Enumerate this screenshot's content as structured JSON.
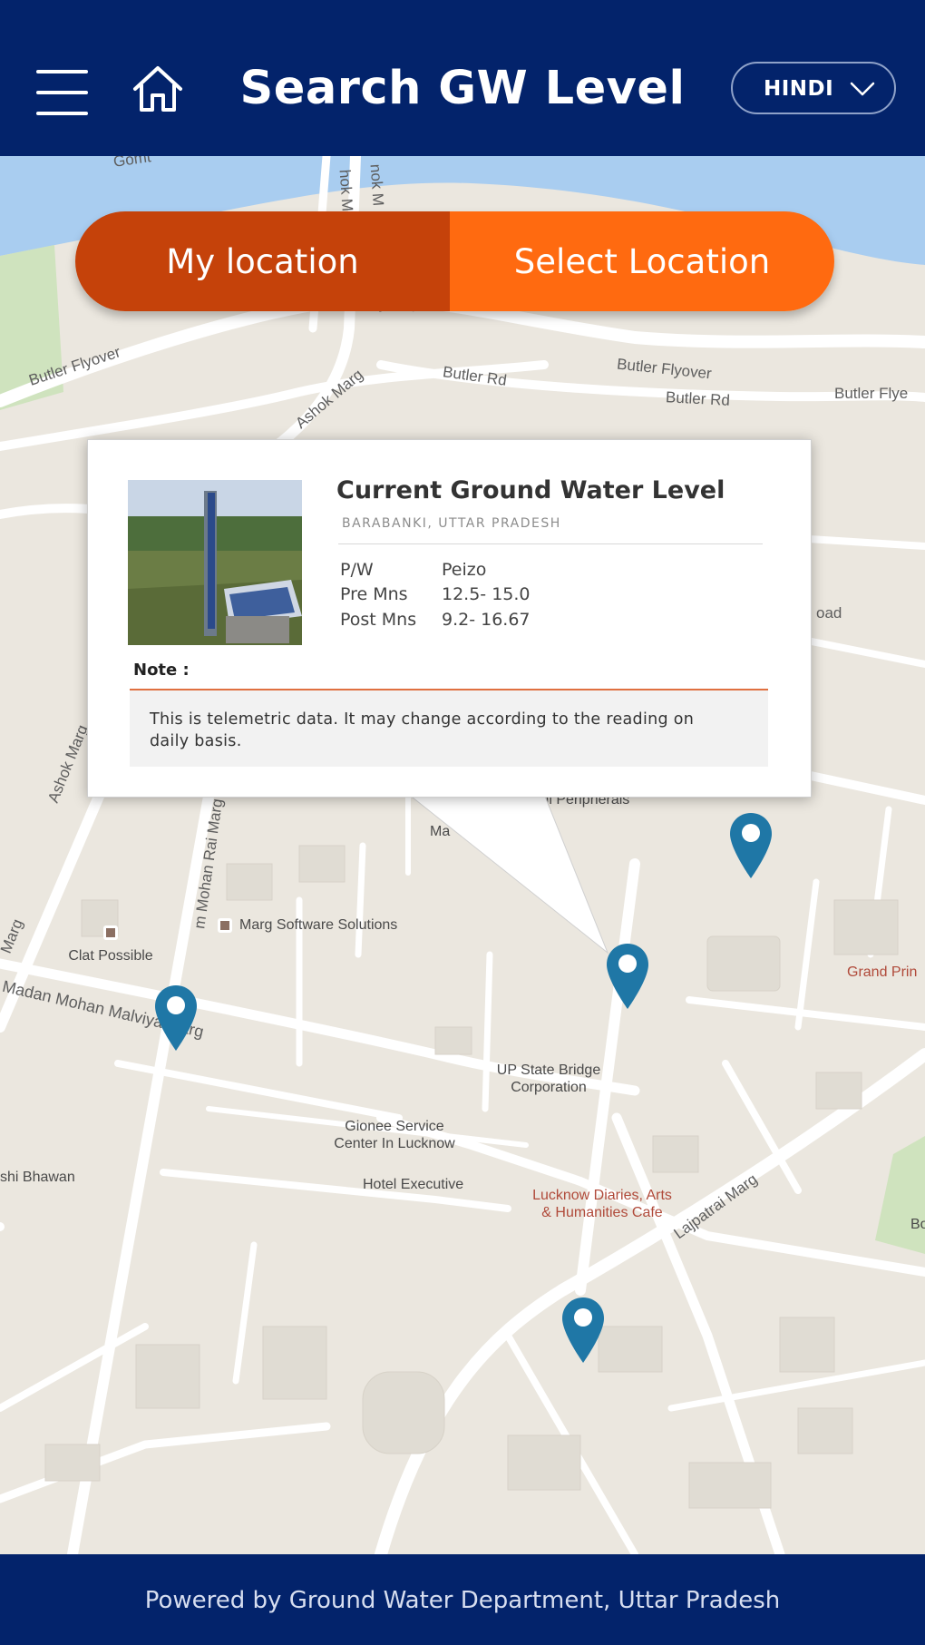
{
  "header": {
    "title": "Search GW Level",
    "language_label": "HINDI",
    "icons": [
      "menu-icon",
      "home-icon",
      "chevron-down-icon"
    ]
  },
  "location_toggle": {
    "my_location_label": "My location",
    "select_location_label": "Select Location"
  },
  "map": {
    "labels": {
      "butler_flyover_left": "Butler Flyover",
      "butler_flyover_right": "Butler Flyover",
      "butler_flyover_edge": "Butler Flye",
      "butler_rd_1": "Butler Rd",
      "butler_rd_2": "Butler Rd",
      "ashok_marg": "Ashok Marg",
      "ashok_marg_left": "Ashok Marg",
      "madan_mohan_malviya_marg": "Madan Mohan Malviya Marg",
      "madan_mohan_rai_marg": "m Mohan Rai Marg",
      "lajpatrai_marg": "Lajpatrai Marg",
      "gomti_top": "Gomt",
      "ashok_m_top": "hok M",
      "ashok_m_top2": "nok M",
      "marg_left": "Marg",
      "road_right": "oad",
      "butler_flyover_top": "Butler Flyover"
    },
    "pois": {
      "marg_software": "Marg Software Solutions",
      "clat_possible": "Clat Possible",
      "up_state_bridge": "UP State Bridge Corporation",
      "gionee": "Gionee Service Center In Lucknow",
      "hotel_executive": "Hotel Executive",
      "lucknow_diaries": "Lucknow Diaries, Arts & Humanities Cafe",
      "shi_bhawan": "shi Bhawan",
      "grand_prin": "Grand Prin",
      "hashi_peripherals": "Hashi Peripherals",
      "ma": "Ma",
      "bo": "Bo"
    }
  },
  "popup": {
    "title": "Current Ground Water Level",
    "subtitle": "BARABANKI, UTTAR PRADESH",
    "rows": [
      {
        "key": "P/W",
        "value": "Peizo"
      },
      {
        "key": "Pre Mns",
        "value": "12.5- 15.0"
      },
      {
        "key": "Post Mns",
        "value": "9.2- 16.67"
      }
    ],
    "note_label": "Note :",
    "note_text": "This is telemetric data. It may change according to the reading on daily basis."
  },
  "colors": {
    "header_bg": "#03236b",
    "my_location_bg": "#c5420a",
    "select_location_bg": "#ff6a10",
    "pin": "#1f77a6",
    "note_accent": "#e07040"
  },
  "footer": {
    "text": "Powered by Ground Water Department, Uttar Pradesh"
  }
}
